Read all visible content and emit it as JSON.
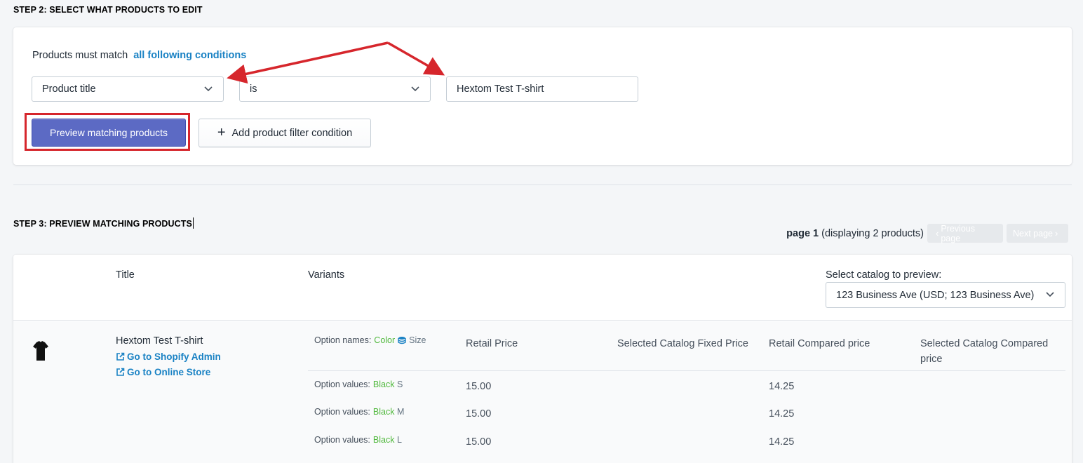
{
  "step2": {
    "title": "STEP 2: SELECT WHAT PRODUCTS TO EDIT"
  },
  "conditions": {
    "prefix": "Products must match",
    "match_mode": "all following conditions",
    "field": "Product title",
    "operator": "is",
    "value": "Hextom Test T-shirt"
  },
  "buttons": {
    "preview": "Preview matching products",
    "add_condition": "Add product filter condition"
  },
  "step3": {
    "title": "STEP 3: PREVIEW MATCHING PRODUCTS"
  },
  "pager": {
    "page_label": "page 1",
    "display_text": "(displaying 2 products)",
    "prev": "Previous page",
    "next": "Next page"
  },
  "table": {
    "col_title": "Title",
    "col_variants": "Variants",
    "catalog_label": "Select catalog to preview:",
    "catalog_value": "123 Business Ave (USD; 123 Business Ave)"
  },
  "product": {
    "title": "Hextom Test T-shirt",
    "link_admin": "Go to Shopify Admin",
    "link_store": "Go to Online Store",
    "option_names_label": "Option names:",
    "option_name_1": "Color",
    "option_name_2": "Size",
    "columns": [
      "Retail Price",
      "Selected Catalog Fixed Price",
      "Retail Compared price",
      "Selected Catalog Compared price"
    ],
    "option_values_label": "Option values:",
    "variants": [
      {
        "color": "Black",
        "size": "S",
        "retail": "15.00",
        "compared": "14.25"
      },
      {
        "color": "Black",
        "size": "M",
        "retail": "15.00",
        "compared": "14.25"
      },
      {
        "color": "Black",
        "size": "L",
        "retail": "15.00",
        "compared": "14.25"
      }
    ]
  },
  "colors": {
    "primary": "#5c6ac4",
    "link": "#1a82c4",
    "option_green": "#50b83c",
    "annotation_red": "#d6262c"
  }
}
